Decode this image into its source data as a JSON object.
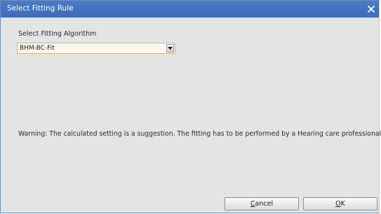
{
  "window": {
    "title": "Select Fitting Rule",
    "close_icon": "close-icon"
  },
  "algorithm": {
    "label": "Select Fitting Algorithm",
    "selected": "BHM-BC-Fit",
    "dropdown_icon": "chevron-down-icon"
  },
  "warning": {
    "text": "Warning: The calculated setting is a suggestion. The fitting has to be performed by a Hearing care professional."
  },
  "buttons": {
    "cancel_accel": "C",
    "cancel_rest": "ancel",
    "ok_accel": "O",
    "ok_rest": "K"
  },
  "colors": {
    "titlebar": "#3d6cb9",
    "body": "#e4e4e4",
    "select_border": "#d9b47a"
  }
}
